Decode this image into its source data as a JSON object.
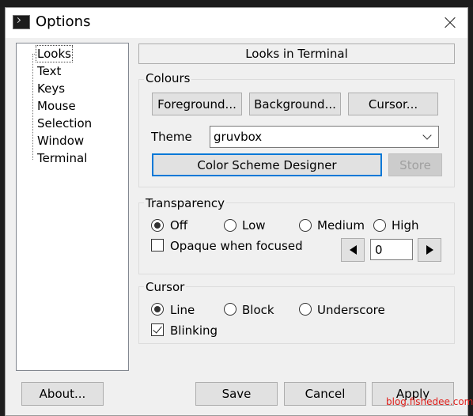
{
  "window": {
    "title": "Options"
  },
  "tree": {
    "items": [
      {
        "label": "Looks",
        "selected": true
      },
      {
        "label": "Text"
      },
      {
        "label": "Keys"
      },
      {
        "label": "Mouse"
      },
      {
        "label": "Selection"
      },
      {
        "label": "Window"
      },
      {
        "label": "Terminal"
      }
    ]
  },
  "page": {
    "header": "Looks in Terminal"
  },
  "colours": {
    "label": "Colours",
    "foreground": "Foreground...",
    "background": "Background...",
    "cursor": "Cursor...",
    "theme_label": "Theme",
    "theme_value": "gruvbox",
    "designer": "Color Scheme Designer",
    "store": "Store"
  },
  "transparency": {
    "label": "Transparency",
    "options": [
      "Off",
      "Low",
      "Medium",
      "High"
    ],
    "selected": "Off",
    "opaque_label": "Opaque when focused",
    "opaque_checked": false,
    "value": "0"
  },
  "cursor": {
    "label": "Cursor",
    "options": [
      "Line",
      "Block",
      "Underscore"
    ],
    "selected": "Line",
    "blinking_label": "Blinking",
    "blinking_checked": true
  },
  "footer": {
    "about": "About...",
    "save": "Save",
    "cancel": "Cancel",
    "apply": "Apply"
  },
  "watermark": "blog.fishedee.com",
  "colors": {
    "focus_accent": "#0078d7",
    "watermark": "#e0201c"
  }
}
